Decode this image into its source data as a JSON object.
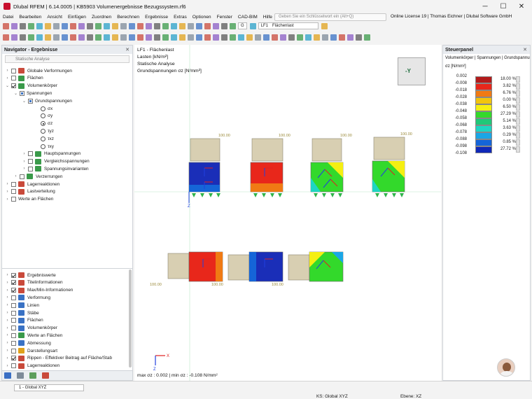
{
  "window": {
    "title": "Dlubal RFEM | 6.14.0005 | KB5903 Volumenergebnisse Bezugssystem.rf6",
    "minimize": "─",
    "maximize": "☐",
    "close": "✕"
  },
  "menu": [
    "Datei",
    "Bearbeiten",
    "Ansicht",
    "Einfügen",
    "Zuordnen",
    "Berechnen",
    "Ergebnisse",
    "Extras",
    "Optionen",
    "Fenster",
    "CAD-BIM",
    "Hilfe"
  ],
  "search": {
    "placeholder": "Geben Sie ein Schlüsselwort ein (Alt+Q)"
  },
  "license": "Online License 19 | Thomas Eichner | Dlubal Software GmbH",
  "toolbar": {
    "load_case_type": "G",
    "load_case_code": "LF1",
    "load_case_name": "Flächenlast"
  },
  "navigator": {
    "title": "Navigator - Ergebnisse",
    "selector": "Statische Analyse",
    "tree": [
      {
        "label": "Globale Verformungen"
      },
      {
        "label": "Flächen"
      },
      {
        "label": "Volumenkörper"
      },
      {
        "label": "Spannungen"
      },
      {
        "label": "Grundspannungen"
      },
      {
        "label": "σx"
      },
      {
        "label": "σy"
      },
      {
        "label": "σz"
      },
      {
        "label": "τyz"
      },
      {
        "label": "τxz"
      },
      {
        "label": "τxy"
      },
      {
        "label": "Hauptspannungen"
      },
      {
        "label": "Vergleichsspannungen"
      },
      {
        "label": "Spannungsinvarianten"
      },
      {
        "label": "Verzerrungen"
      },
      {
        "label": "Lagerreaktionen"
      },
      {
        "label": "Lastverteilung"
      },
      {
        "label": "Werte an Flächen"
      }
    ],
    "options": [
      {
        "label": "Ergebniswerte"
      },
      {
        "label": "Titelinformationen"
      },
      {
        "label": "Max/Min-Informationen"
      },
      {
        "label": "Verformung"
      },
      {
        "label": "Linien"
      },
      {
        "label": "Stäbe"
      },
      {
        "label": "Flächen"
      },
      {
        "label": "Volumenkörper"
      },
      {
        "label": "Werte an Flächen"
      },
      {
        "label": "Abmessung"
      },
      {
        "label": "Darstellungsart"
      },
      {
        "label": "Rippen - Effektiver Beitrag auf Fläche/Stab"
      },
      {
        "label": "Lagerreaktionen"
      }
    ]
  },
  "viewport": {
    "info_lines": [
      "LF1 - Flächenlast",
      "Lasten [kN/m²]",
      "Statische Analyse",
      "Grundspannungen σz [N/mm²]"
    ],
    "view_cube_label": "-Y",
    "load_labels": [
      "100.00",
      "100.00",
      "100.00",
      "100.00",
      "100.00",
      "100.00",
      "100.00"
    ],
    "footer": "max σz : 0.002 | min σz : -0.108 N/mm²"
  },
  "control_panel": {
    "title": "Steuerpanel",
    "subtitle": "Volumenkörper | Spannungen | Grundspannungen",
    "quantity": "σz [N/mm²]",
    "legend": [
      {
        "value": "0.002",
        "color": "#b31b1b",
        "percent": "18.00 %"
      },
      {
        "value": "-0.008",
        "color": "#e8271b",
        "percent": "3.82 %"
      },
      {
        "value": "-0.018",
        "color": "#f07a14",
        "percent": "6.76 %"
      },
      {
        "value": "-0.028",
        "color": "#f2c40d",
        "percent": "0.00 %"
      },
      {
        "value": "-0.038",
        "color": "#f5ef12",
        "percent": "6.50 %"
      },
      {
        "value": "-0.048",
        "color": "#33d92b",
        "percent": "27.29 %"
      },
      {
        "value": "-0.058",
        "color": "#20c878",
        "percent": "5.14 %"
      },
      {
        "value": "-0.068",
        "color": "#1ed6c2",
        "percent": "3.63 %"
      },
      {
        "value": "-0.078",
        "color": "#1aa6e6",
        "percent": "0.29 %"
      },
      {
        "value": "-0.088",
        "color": "#1565d8",
        "percent": "0.85 %"
      },
      {
        "value": "-0.098",
        "color": "#1028b8",
        "percent": "27.72 %"
      }
    ],
    "legend_last_value": "-0.108"
  },
  "status": {
    "coord_system": "1 - Global XYZ",
    "ks": "KS: Global XYZ",
    "plane": "Ebene: XZ"
  }
}
